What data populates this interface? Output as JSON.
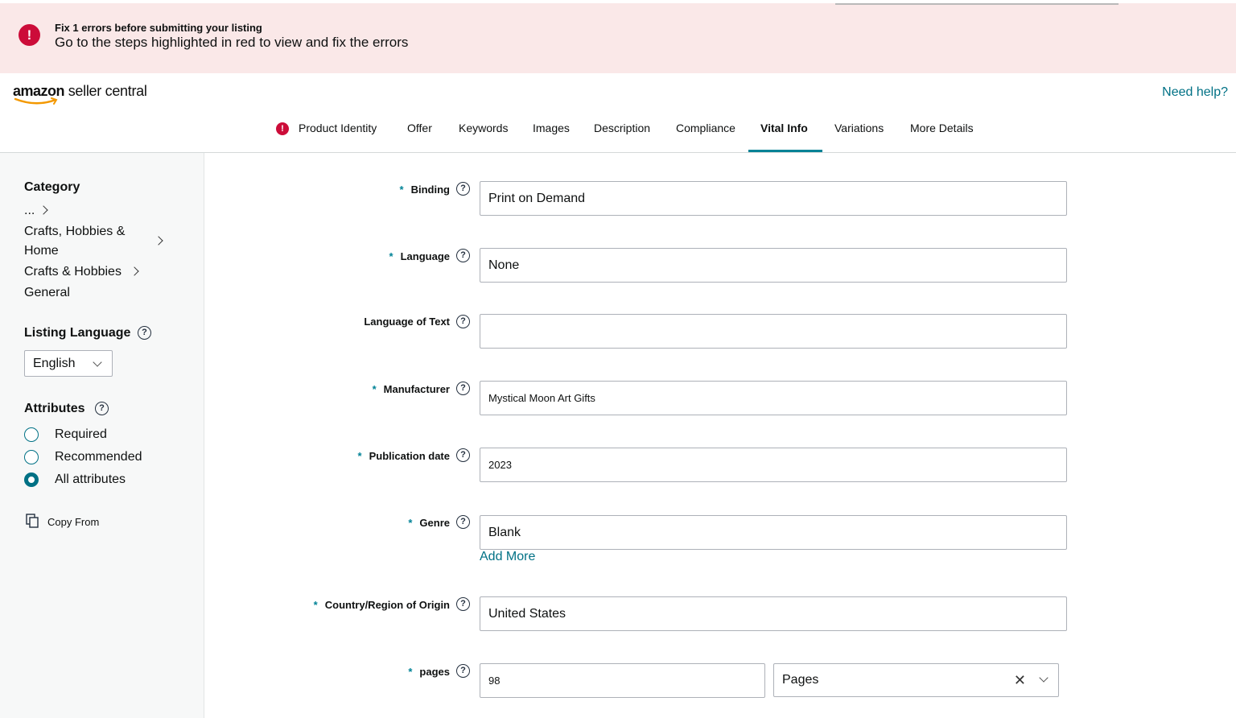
{
  "banner": {
    "title": "Fix 1 errors before submitting your listing",
    "message": "Go to the steps highlighted in red to view and fix the errors",
    "icon": "exclamation-icon"
  },
  "header": {
    "logo_amazon": "amazon",
    "logo_rest": " seller central",
    "help_link": "Need help?"
  },
  "tabs": [
    {
      "label": "Product Identity",
      "error": true
    },
    {
      "label": "Offer"
    },
    {
      "label": "Keywords"
    },
    {
      "label": "Images"
    },
    {
      "label": "Description"
    },
    {
      "label": "Compliance"
    },
    {
      "label": "Vital Info",
      "active": true
    },
    {
      "label": "Variations"
    },
    {
      "label": "More Details"
    }
  ],
  "sidebar": {
    "category_heading": "Category",
    "breadcrumb": [
      "...",
      "Crafts, Hobbies &",
      "Home",
      "Crafts & Hobbies",
      "General"
    ],
    "listing_language_heading": "Listing Language",
    "listing_language_value": "English",
    "attributes_heading": "Attributes",
    "attribute_options": [
      "Required",
      "Recommended",
      "All attributes"
    ],
    "selected_attribute": "All attributes",
    "copy_from": "Copy From"
  },
  "form": {
    "fields": [
      {
        "label": "Binding",
        "required": true,
        "value": "Print on Demand"
      },
      {
        "label": "Language",
        "required": true,
        "value": "None"
      },
      {
        "label": "Language of Text",
        "required": false,
        "value": ""
      },
      {
        "label": "Manufacturer",
        "required": true,
        "value": "Mystical Moon Art Gifts"
      },
      {
        "label": "Publication date",
        "required": true,
        "value": "2023"
      },
      {
        "label": "Genre",
        "required": true,
        "value": "Blank"
      },
      {
        "label": "Country/Region of Origin",
        "required": true,
        "value": "United States"
      },
      {
        "label": "pages",
        "required": true,
        "value": "98"
      }
    ],
    "add_more": "Add More",
    "pages_unit": "Pages",
    "help_glyph": "?",
    "required_marker": "*",
    "clear_glyph": "✕"
  },
  "colors": {
    "accent": "#007185",
    "tab_active": "#008296",
    "error": "#cc0c39",
    "banner_bg": "#fae8e8"
  }
}
